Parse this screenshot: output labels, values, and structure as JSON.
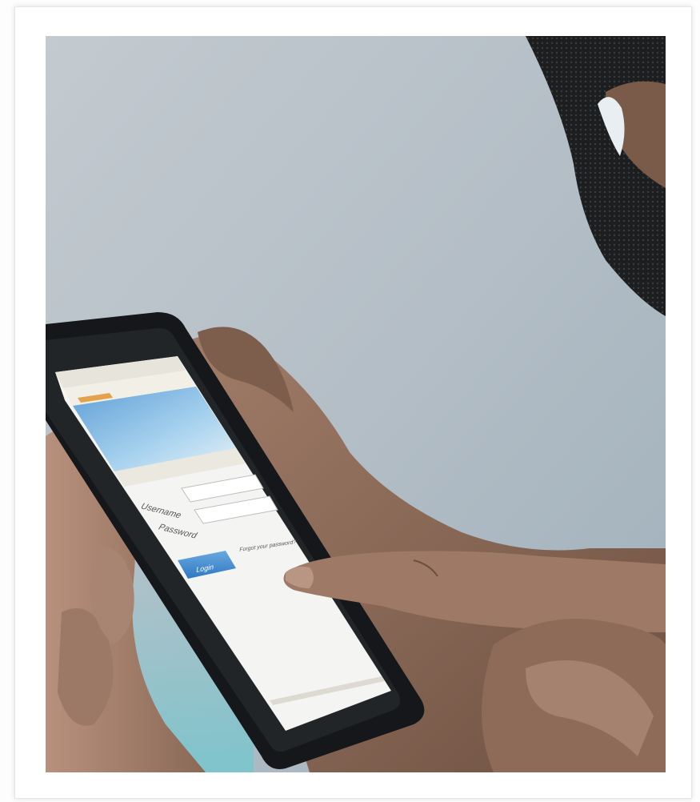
{
  "photo": {
    "description_free": true,
    "colors": {
      "background_wall": "#b9c2c9",
      "phone_body": "#1b1d1f",
      "screen": "#f4f4f2",
      "banner": "#7fb6e2",
      "skin": "#8b6a58",
      "skin_light": "#b69381",
      "mask": "#1e2022",
      "login_button": "#3a86cf"
    }
  },
  "phone_screen": {
    "username_label": "Username",
    "password_label": "Password",
    "login_button": "Login",
    "forgot_link": "Forgot your password?"
  }
}
